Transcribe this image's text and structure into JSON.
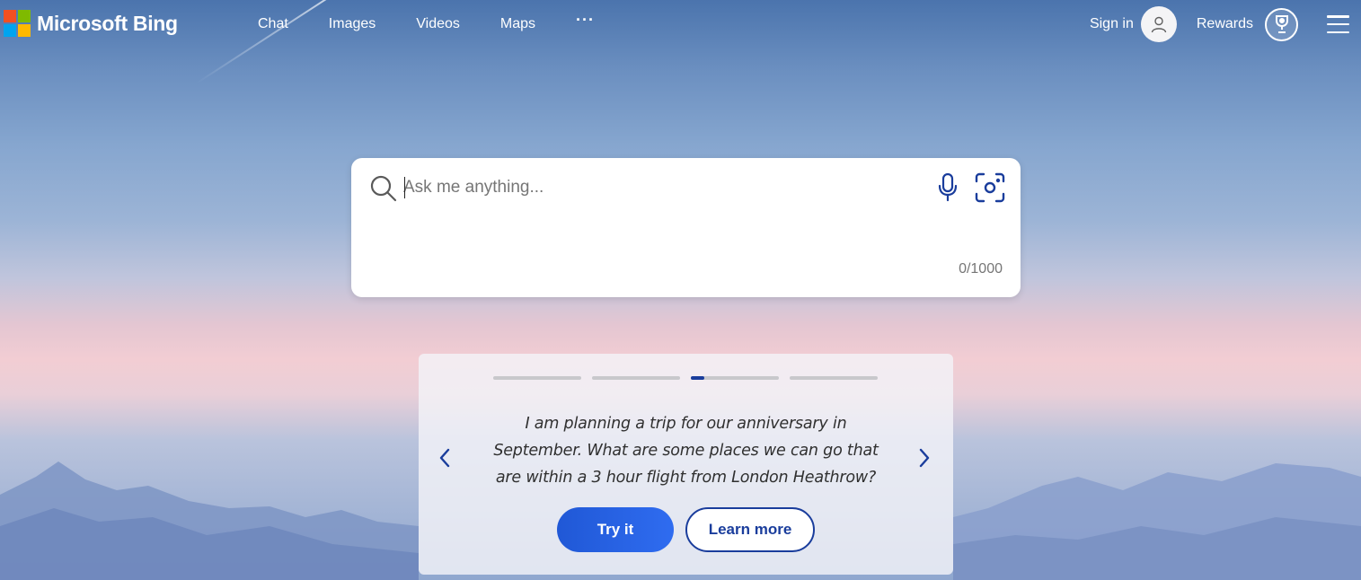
{
  "brand": {
    "name": "Microsoft Bing",
    "colors": {
      "red": "#f25022",
      "green": "#7fba00",
      "blue": "#00a4ef",
      "yellow": "#ffb900"
    }
  },
  "nav": {
    "items": [
      {
        "label": "Chat"
      },
      {
        "label": "Images"
      },
      {
        "label": "Videos"
      },
      {
        "label": "Maps"
      }
    ],
    "more_label": "···"
  },
  "header_right": {
    "sign_in": "Sign in",
    "avatar_icon": "user-avatar-icon",
    "rewards": "Rewards",
    "rewards_icon": "trophy-icon",
    "menu_icon": "hamburger-menu-icon"
  },
  "search": {
    "placeholder": "Ask me anything...",
    "value": "",
    "char_count": "0/1000",
    "icons": [
      "search-icon",
      "microphone-icon",
      "visual-search-icon"
    ],
    "accent": "#1a3d9c"
  },
  "suggestion": {
    "active_index": 2,
    "active_progress": 0.15,
    "total": 4,
    "text": "I am planning a trip for our anniversary in September. What are some places we can go that are within a 3 hour flight from London Heathrow?",
    "try_label": "Try it",
    "learn_label": "Learn more"
  }
}
